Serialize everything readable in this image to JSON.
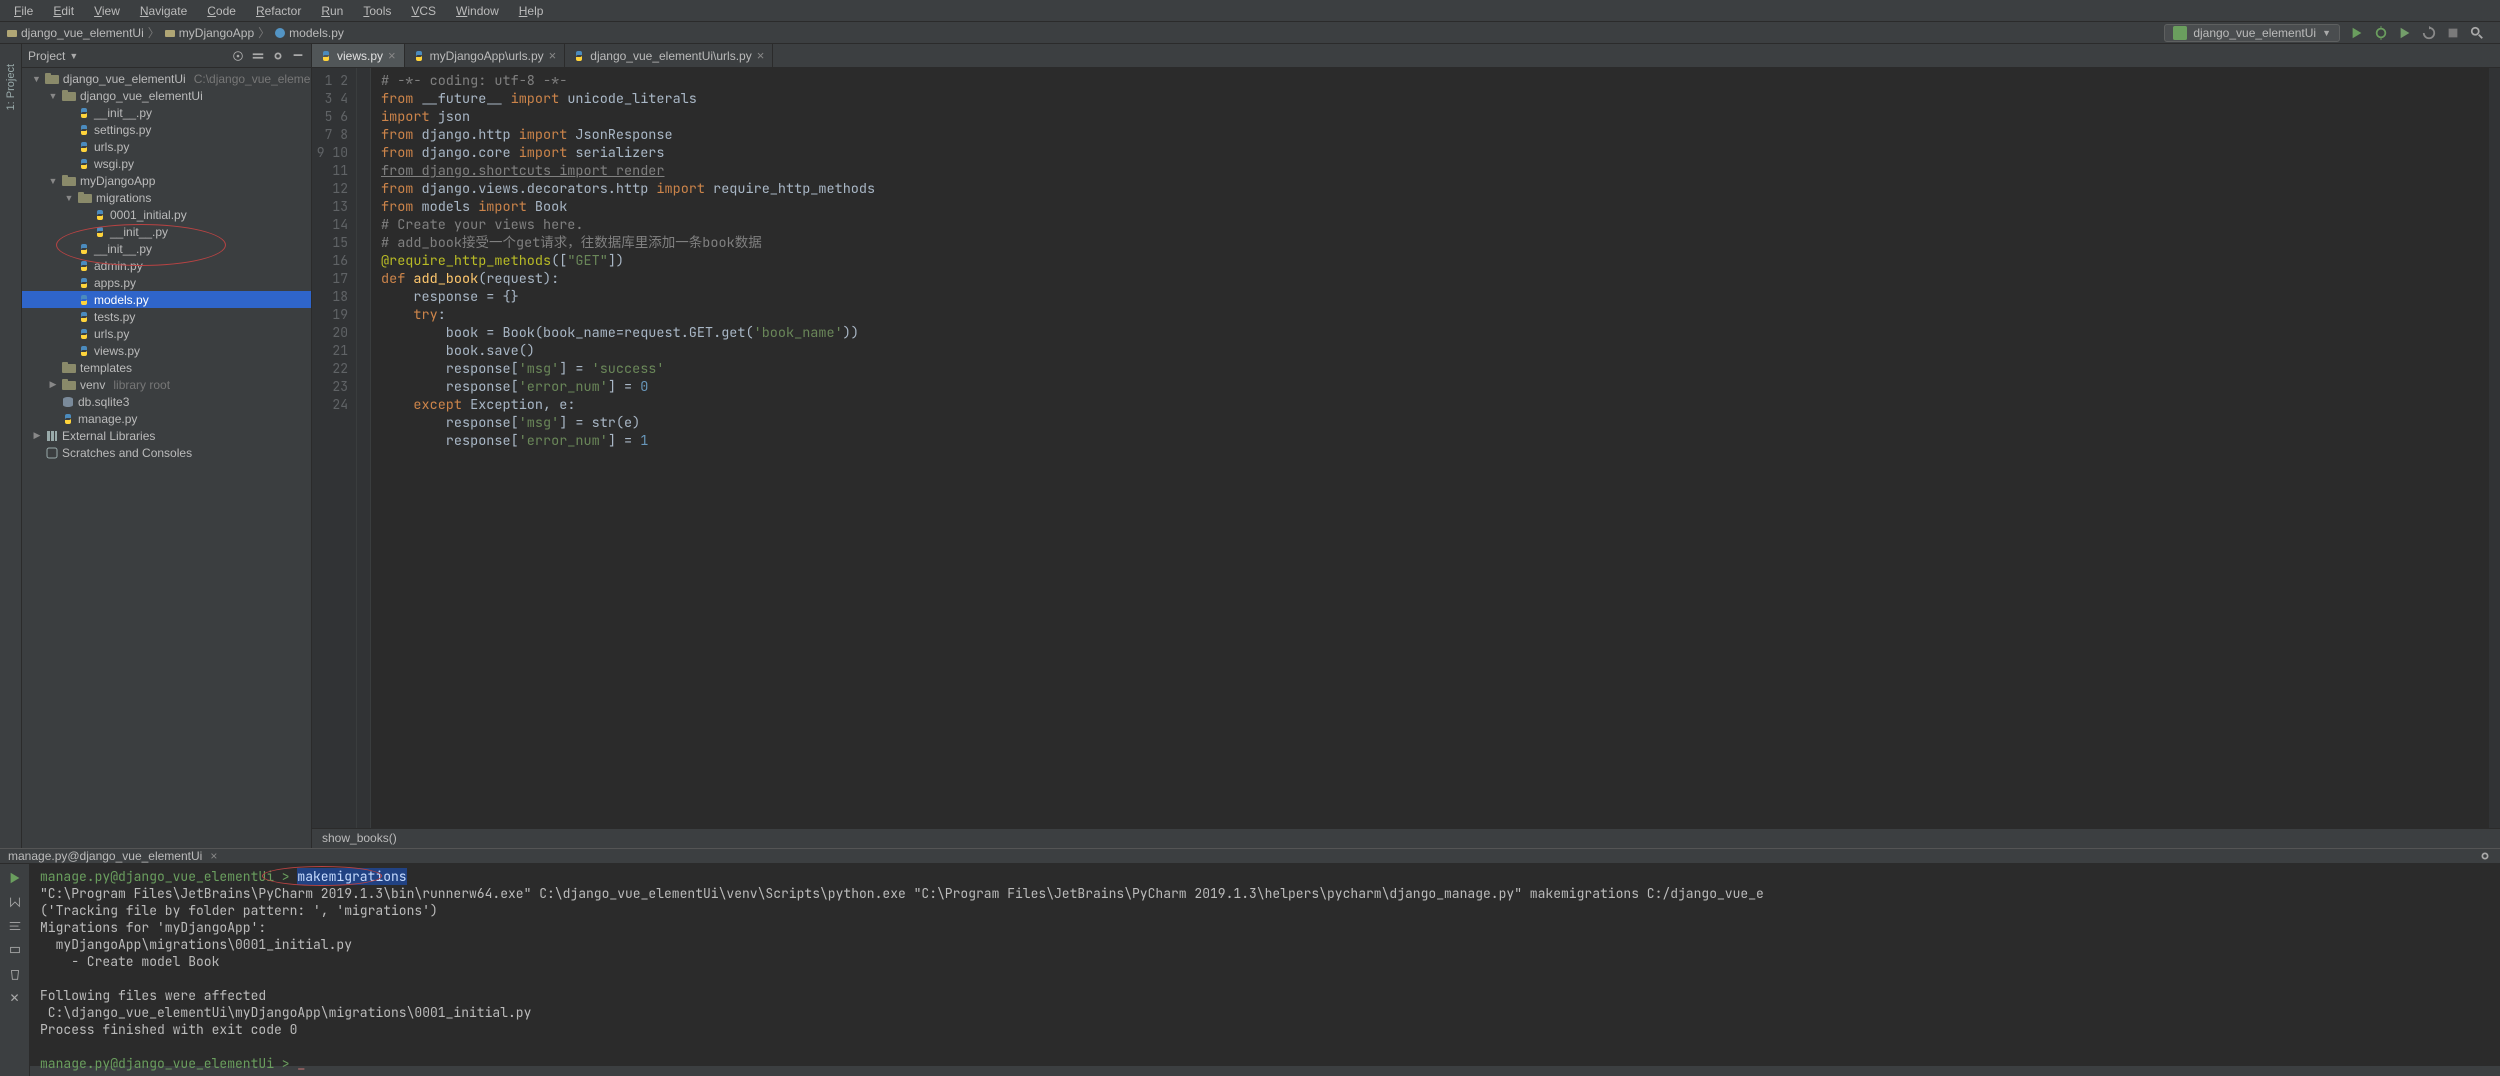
{
  "menu": [
    "File",
    "Edit",
    "View",
    "Navigate",
    "Code",
    "Refactor",
    "Run",
    "Tools",
    "VCS",
    "Window",
    "Help"
  ],
  "breadcrumb": [
    "django_vue_elementUi",
    "myDjangoApp",
    "models.py"
  ],
  "run_config": "django_vue_elementUi",
  "project_panel": {
    "title": "Project",
    "root_label": "django_vue_elementUi",
    "root_path": "C:\\django_vue_elementUi"
  },
  "tree": [
    {
      "depth": 0,
      "arrow": "open",
      "icon": "folder",
      "label": "django_vue_elementUi",
      "dim": "C:\\django_vue_elementUi"
    },
    {
      "depth": 1,
      "arrow": "open",
      "icon": "folder",
      "label": "django_vue_elementUi"
    },
    {
      "depth": 2,
      "arrow": "none",
      "icon": "py",
      "label": "__init__.py"
    },
    {
      "depth": 2,
      "arrow": "none",
      "icon": "py",
      "label": "settings.py"
    },
    {
      "depth": 2,
      "arrow": "none",
      "icon": "py",
      "label": "urls.py"
    },
    {
      "depth": 2,
      "arrow": "none",
      "icon": "py",
      "label": "wsgi.py"
    },
    {
      "depth": 1,
      "arrow": "open",
      "icon": "folder",
      "label": "myDjangoApp"
    },
    {
      "depth": 2,
      "arrow": "open",
      "icon": "folder",
      "label": "migrations"
    },
    {
      "depth": 3,
      "arrow": "none",
      "icon": "py",
      "label": "0001_initial.py"
    },
    {
      "depth": 3,
      "arrow": "none",
      "icon": "py",
      "label": "__init__.py"
    },
    {
      "depth": 2,
      "arrow": "none",
      "icon": "py",
      "label": "__init__.py"
    },
    {
      "depth": 2,
      "arrow": "none",
      "icon": "py",
      "label": "admin.py"
    },
    {
      "depth": 2,
      "arrow": "none",
      "icon": "py",
      "label": "apps.py"
    },
    {
      "depth": 2,
      "arrow": "none",
      "icon": "py",
      "label": "models.py",
      "selected": true
    },
    {
      "depth": 2,
      "arrow": "none",
      "icon": "py",
      "label": "tests.py"
    },
    {
      "depth": 2,
      "arrow": "none",
      "icon": "py",
      "label": "urls.py"
    },
    {
      "depth": 2,
      "arrow": "none",
      "icon": "py",
      "label": "views.py"
    },
    {
      "depth": 1,
      "arrow": "none",
      "icon": "folder",
      "label": "templates"
    },
    {
      "depth": 1,
      "arrow": "closed",
      "icon": "folder",
      "label": "venv",
      "dim": "library root"
    },
    {
      "depth": 1,
      "arrow": "none",
      "icon": "db",
      "label": "db.sqlite3"
    },
    {
      "depth": 1,
      "arrow": "none",
      "icon": "py",
      "label": "manage.py"
    },
    {
      "depth": 0,
      "arrow": "closed",
      "icon": "lib",
      "label": "External Libraries"
    },
    {
      "depth": 0,
      "arrow": "none",
      "icon": "scratch",
      "label": "Scratches and Consoles"
    }
  ],
  "tabs": [
    {
      "label": "views.py",
      "active": true
    },
    {
      "label": "myDjangoApp\\urls.py",
      "active": false
    },
    {
      "label": "django_vue_elementUi\\urls.py",
      "active": false
    }
  ],
  "code_lines": [
    [
      {
        "c": "cmt",
        "t": "# -*- coding: utf-8 -*-"
      }
    ],
    [
      {
        "c": "kw",
        "t": "from "
      },
      {
        "t": "__future__ "
      },
      {
        "c": "kw",
        "t": "import "
      },
      {
        "t": "unicode_literals"
      }
    ],
    [
      {
        "c": "kw",
        "t": "import "
      },
      {
        "t": "json"
      }
    ],
    [
      {
        "c": "kw",
        "t": "from "
      },
      {
        "t": "django.http "
      },
      {
        "c": "kw",
        "t": "import "
      },
      {
        "t": "JsonResponse"
      }
    ],
    [
      {
        "c": "kw",
        "t": "from "
      },
      {
        "t": "django.core "
      },
      {
        "c": "kw",
        "t": "import "
      },
      {
        "t": "serializers"
      }
    ],
    [
      {
        "c": "und",
        "t": "from django.shortcuts import render"
      }
    ],
    [
      {
        "c": "kw",
        "t": "from "
      },
      {
        "t": "django.views.decorators.http "
      },
      {
        "c": "kw",
        "t": "import "
      },
      {
        "t": "require_http_methods"
      }
    ],
    [
      {
        "t": ""
      }
    ],
    [
      {
        "c": "kw",
        "t": "from "
      },
      {
        "t": "models "
      },
      {
        "c": "kw",
        "t": "import "
      },
      {
        "t": "Book"
      }
    ],
    [
      {
        "c": "cmt",
        "t": "# Create your views here."
      }
    ],
    [
      {
        "c": "cmt",
        "t": "# add_book接受一个get请求，往数据库里添加一条book数据"
      }
    ],
    [
      {
        "c": "dec",
        "t": "@require_http_methods"
      },
      {
        "t": "(["
      },
      {
        "c": "st",
        "t": "\"GET\""
      },
      {
        "t": "])"
      }
    ],
    [
      {
        "c": "kw",
        "t": "def "
      },
      {
        "c": "fn",
        "t": "add_book"
      },
      {
        "t": "(request):"
      }
    ],
    [
      {
        "t": "    response = {}"
      }
    ],
    [
      {
        "t": "    "
      },
      {
        "c": "kw",
        "t": "try"
      },
      {
        "t": ":"
      }
    ],
    [
      {
        "t": "        book = Book("
      },
      {
        "c": "",
        "t": "book_name"
      },
      {
        "t": "=request.GET.get("
      },
      {
        "c": "st",
        "t": "'book_name'"
      },
      {
        "t": "))"
      }
    ],
    [
      {
        "t": "        book.save()"
      }
    ],
    [
      {
        "t": "        response["
      },
      {
        "c": "st",
        "t": "'msg'"
      },
      {
        "t": "] = "
      },
      {
        "c": "st",
        "t": "'success'"
      }
    ],
    [
      {
        "t": "        response["
      },
      {
        "c": "st",
        "t": "'error_num'"
      },
      {
        "t": "] = "
      },
      {
        "c": "num",
        "t": "0"
      }
    ],
    [
      {
        "t": "    "
      },
      {
        "c": "kw",
        "t": "except "
      },
      {
        "t": "Exception"
      },
      {
        "c": "",
        "t": ", "
      },
      {
        "t": "e:"
      }
    ],
    [
      {
        "t": "        response["
      },
      {
        "c": "st",
        "t": "'msg'"
      },
      {
        "t": "] = str(e)"
      }
    ],
    [
      {
        "t": "        response["
      },
      {
        "c": "st",
        "t": "'error_num'"
      },
      {
        "t": "] = "
      },
      {
        "c": "num",
        "t": "1"
      }
    ],
    [
      {
        "t": ""
      }
    ],
    [
      {
        "t": ""
      }
    ]
  ],
  "code_breadcrumb": "show_books()",
  "bottom_tab": "manage.py@django_vue_elementUi",
  "console": {
    "prompt1_path": "manage.py@django_vue_elementUi > ",
    "cmd": "makemigrations",
    "lines": [
      "\"C:\\Program Files\\JetBrains\\PyCharm 2019.1.3\\bin\\runnerw64.exe\" C:\\django_vue_elementUi\\venv\\Scripts\\python.exe \"C:\\Program Files\\JetBrains\\PyCharm 2019.1.3\\helpers\\pycharm\\django_manage.py\" makemigrations C:/django_vue_e",
      "('Tracking file by folder pattern: ', 'migrations')",
      "Migrations for 'myDjangoApp':",
      "  myDjangoApp\\migrations\\0001_initial.py",
      "    - Create model Book",
      "",
      "Following files were affected ",
      " C:\\django_vue_elementUi\\myDjangoApp\\migrations\\0001_initial.py",
      "Process finished with exit code 0",
      ""
    ],
    "prompt2": "manage.py@django_vue_elementUi > ",
    "cursor": "_"
  },
  "left_gutter": "1: Project"
}
